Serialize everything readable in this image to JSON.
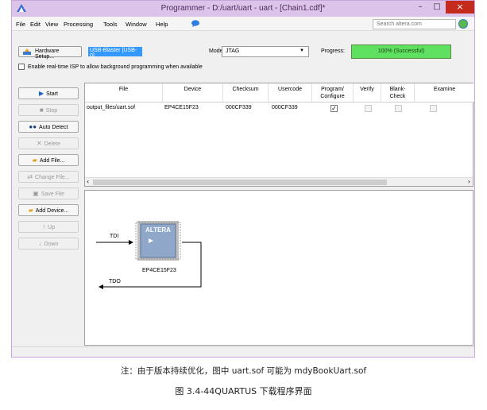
{
  "window": {
    "title": "Programmer - D:/uart/uart - uart - [Chain1.cdf]*",
    "controls": {
      "minimize": "–",
      "maximize": "□",
      "close": "×"
    }
  },
  "menubar": {
    "items": [
      "File",
      "Edit",
      "View",
      "Processing",
      "Tools",
      "Window",
      "Help"
    ],
    "search_placeholder": "Search altera.com"
  },
  "toolbar": {
    "hardware_setup_label": "Hardware Setup...",
    "hardware_value": "USB-Blaster [USB-0]",
    "mode_label": "Mode:",
    "mode_value": "JTAG",
    "progress_label": "Progress:",
    "progress_text": "100% (Successful)",
    "progress_percent": 100,
    "progress_color": "#5fe060",
    "isp_label": "Enable real-time ISP to allow background programming when available"
  },
  "side_buttons": [
    {
      "label": "Start",
      "icon": "play-icon",
      "enabled": true
    },
    {
      "label": "Stop",
      "icon": "stop-icon",
      "enabled": false
    },
    {
      "label": "Auto Detect",
      "icon": "binoculars-icon",
      "enabled": true
    },
    {
      "label": "Delete",
      "icon": "delete-icon",
      "enabled": false
    },
    {
      "label": "Add File...",
      "icon": "add-file-icon",
      "enabled": true
    },
    {
      "label": "Change File...",
      "icon": "change-file-icon",
      "enabled": false
    },
    {
      "label": "Save File",
      "icon": "save-icon",
      "enabled": false
    },
    {
      "label": "Add Device...",
      "icon": "add-device-icon",
      "enabled": true
    },
    {
      "label": "Up",
      "icon": "up-icon",
      "enabled": false
    },
    {
      "label": "Down",
      "icon": "down-icon",
      "enabled": false
    }
  ],
  "table": {
    "headers": [
      "File",
      "Device",
      "Checksum",
      "Usercode",
      "Program/\nConfigure",
      "Verify",
      "Blank-\nCheck",
      "Examine"
    ],
    "row": {
      "file": "output_files/uart.sof",
      "device": "EP4CE15F23",
      "checksum": "000CF339",
      "usercode": "000CF339",
      "program_configure": true,
      "verify": false,
      "blank_check": false,
      "examine": false
    }
  },
  "diagram": {
    "tdi_label": "TDI",
    "tdo_label": "TDO",
    "chip_logo": "ALTERA",
    "chip_name": "EP4CE15F23"
  },
  "captions": {
    "note": "注：由于版本持续优化，图中 uart.sof 可能为 mdyBookUart.sof",
    "figure": "图 3.4-44QUARTUS 下载程序界面"
  }
}
